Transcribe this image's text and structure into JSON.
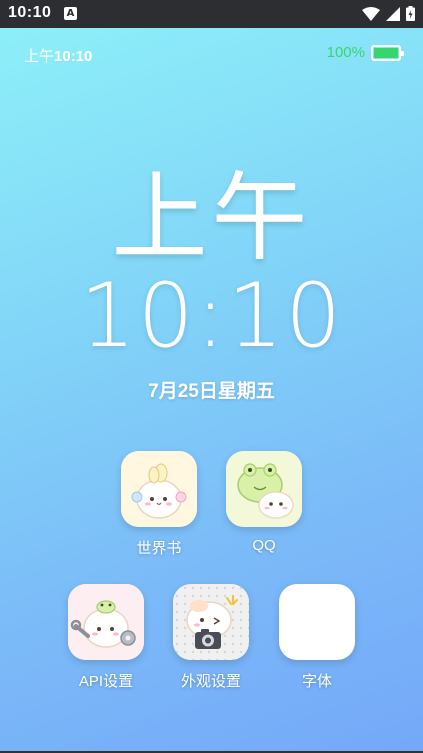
{
  "system_bar": {
    "time": "10:10",
    "notification_letter": "A"
  },
  "status": {
    "ampm": "上午",
    "time": "10:10",
    "battery_percent": "100%",
    "battery_level": 1.0
  },
  "clock": {
    "ampm": "上午",
    "time": "10:10",
    "date": "7月25日星期五"
  },
  "apps": [
    {
      "label": "世界书",
      "icon": "bunny-cat-sticker-icon"
    },
    {
      "label": "QQ",
      "icon": "frog-cat-sticker-icon"
    },
    {
      "label": "API设置",
      "icon": "frog-wrench-sticker-icon"
    },
    {
      "label": "外观设置",
      "icon": "camera-cat-sticker-icon"
    },
    {
      "label": "字体",
      "icon": "blank-app-icon"
    }
  ],
  "colors": {
    "battery_green": "#37d66c",
    "bg_top": "#8deff8",
    "bg_bottom": "#74a8f8"
  }
}
